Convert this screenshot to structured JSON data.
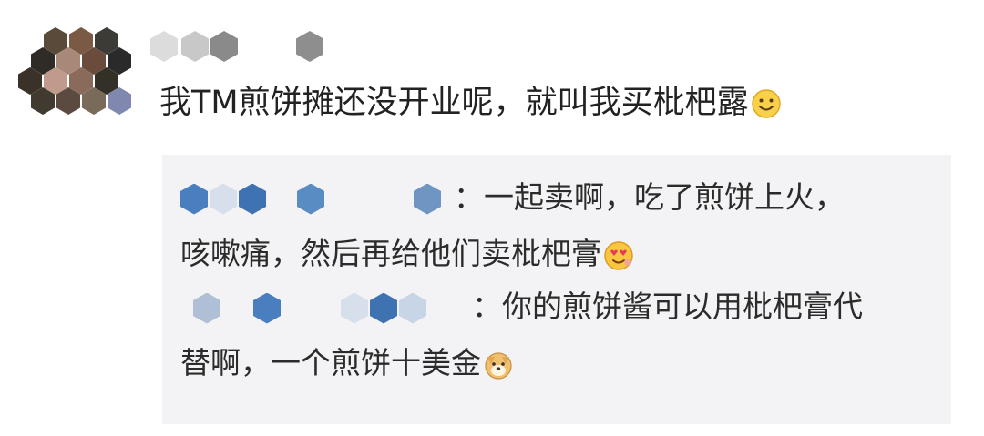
{
  "comment": {
    "text": "我TM煎饼摊还没开业呢，就叫我买枇杷露",
    "emoji": "smile-emoji"
  },
  "replies": [
    {
      "text_line1": "：一起卖啊，吃了煎饼上火，",
      "text_line2": "咳嗽痛，然后再给他们卖枇杷膏",
      "emoji": "heart-eyes-emoji"
    },
    {
      "text_line1": "：你的煎饼酱可以用枇杷膏代",
      "text_line2": "替啊，一个煎饼十美金",
      "emoji": "doge-emoji"
    }
  ],
  "colors": {
    "reply_bg": "#f3f3f5",
    "mosaic_blue": "#4a7fbf",
    "mosaic_light_blue": "#aebfd6",
    "mosaic_gray": "#8a8a8a"
  }
}
